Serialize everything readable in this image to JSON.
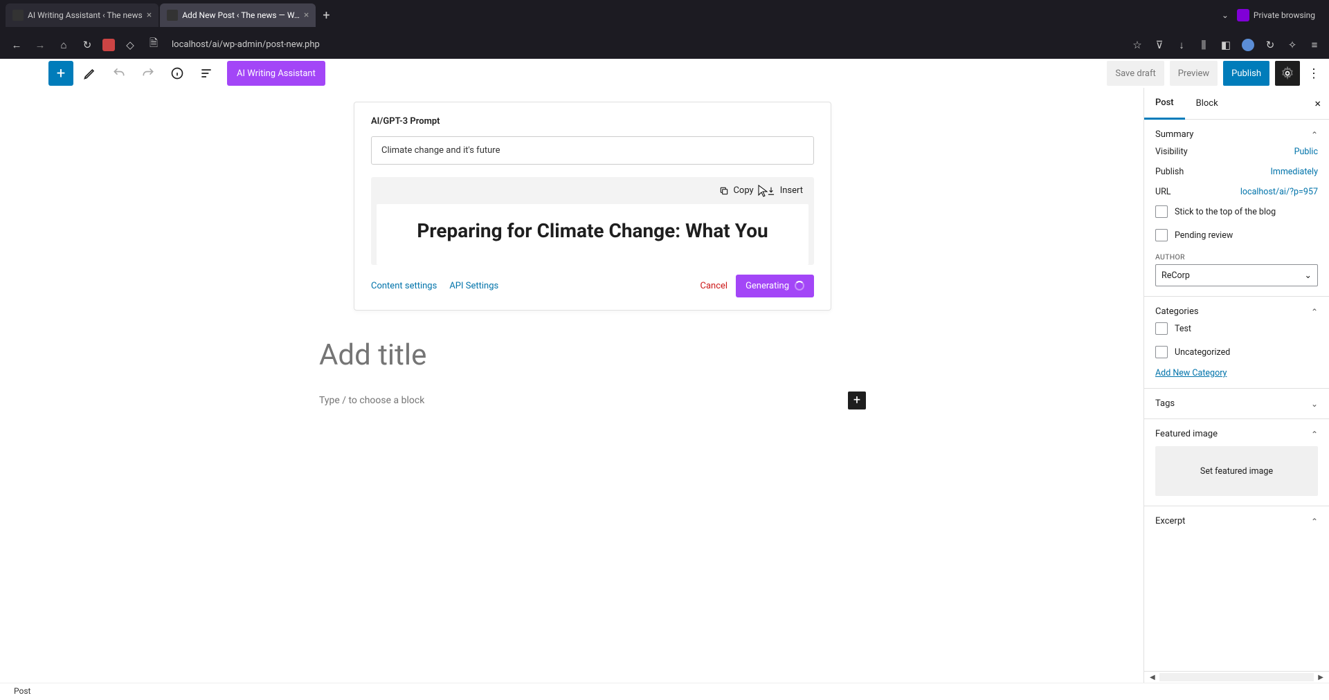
{
  "browser": {
    "tabs": [
      {
        "title": "AI Writing Assistant ‹ The news"
      },
      {
        "title": "Add New Post ‹ The news — W…"
      }
    ],
    "private_label": "Private browsing",
    "url": "localhost/ai/wp-admin/post-new.php"
  },
  "toolbar": {
    "ai_button": "AI Writing Assistant",
    "save_draft": "Save draft",
    "preview": "Preview",
    "publish": "Publish"
  },
  "ai_panel": {
    "title": "AI/GPT-3 Prompt",
    "input_value": "Climate change and it's future",
    "copy": "Copy",
    "insert": "Insert",
    "output": "Preparing for Climate Change: What You",
    "content_settings": "Content settings",
    "api_settings": "API Settings",
    "cancel": "Cancel",
    "generate": "Generating"
  },
  "editor": {
    "title_placeholder": "Add title",
    "block_placeholder": "Type / to choose a block"
  },
  "sidebar": {
    "tab_post": "Post",
    "tab_block": "Block",
    "summary": {
      "label": "Summary",
      "visibility_label": "Visibility",
      "visibility_value": "Public",
      "publish_label": "Publish",
      "publish_value": "Immediately",
      "url_label": "URL",
      "url_value": "localhost/ai/?p=957",
      "sticky": "Stick to the top of the blog",
      "pending": "Pending review",
      "author_label": "AUTHOR",
      "author_value": "ReCorp"
    },
    "categories": {
      "label": "Categories",
      "items": [
        "Test",
        "Uncategorized"
      ],
      "add_new": "Add New Category"
    },
    "tags_label": "Tags",
    "featured": {
      "label": "Featured image",
      "button": "Set featured image"
    },
    "excerpt_label": "Excerpt"
  },
  "status_bar": "Post"
}
